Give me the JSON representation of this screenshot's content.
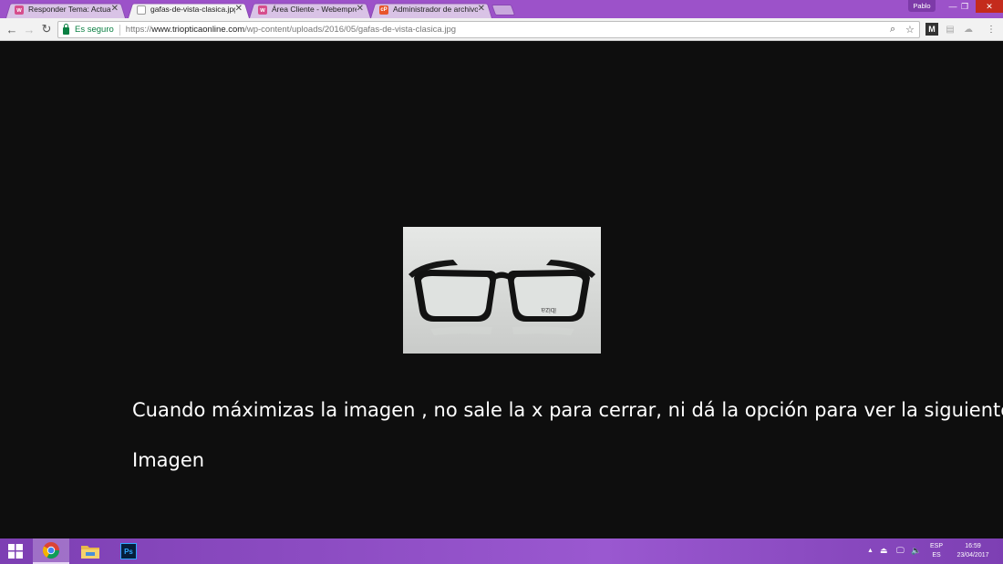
{
  "browser": {
    "tabs": [
      {
        "title": "Responder Tema: Actuali",
        "favicon": "w",
        "favicon_color": "#d64d8c",
        "active": false
      },
      {
        "title": "gafas-de-vista-clasica.jpg",
        "favicon": "",
        "favicon_color": "#cccccc",
        "active": true
      },
      {
        "title": "Área Cliente - Webempre",
        "favicon": "w",
        "favicon_color": "#d64d8c",
        "active": false
      },
      {
        "title": "Administrador de archivo",
        "favicon": "cP",
        "favicon_color": "#e8552c",
        "active": false
      }
    ],
    "profile_name": "Pablo",
    "security_label": "Es seguro",
    "url_scheme": "https://",
    "url_host": "www.triopticaonline.com",
    "url_path": "/wp-content/uploads/2016/05/gafas-de-vista-clasica.jpg"
  },
  "page": {
    "caption_line1": "Cuando máximizas la imagen , no sale la x para cerrar, ni dá la opción para ver la siguiente",
    "caption_line2": "Imagen",
    "image_brand_text": "ibiza"
  },
  "taskbar": {
    "apps": [
      {
        "name": "chrome",
        "icon": "chrome-icon"
      },
      {
        "name": "file-explorer",
        "icon": "folder-icon"
      },
      {
        "name": "photoshop",
        "icon": "photoshop-icon",
        "label": "Ps"
      }
    ],
    "language_top": "ESP",
    "language_bottom": "ES",
    "time": "16:59",
    "date": "23/04/2017"
  },
  "colors": {
    "accent": "#9c52c9",
    "secure_green": "#0b8043",
    "page_bg": "#0e0e0e"
  }
}
